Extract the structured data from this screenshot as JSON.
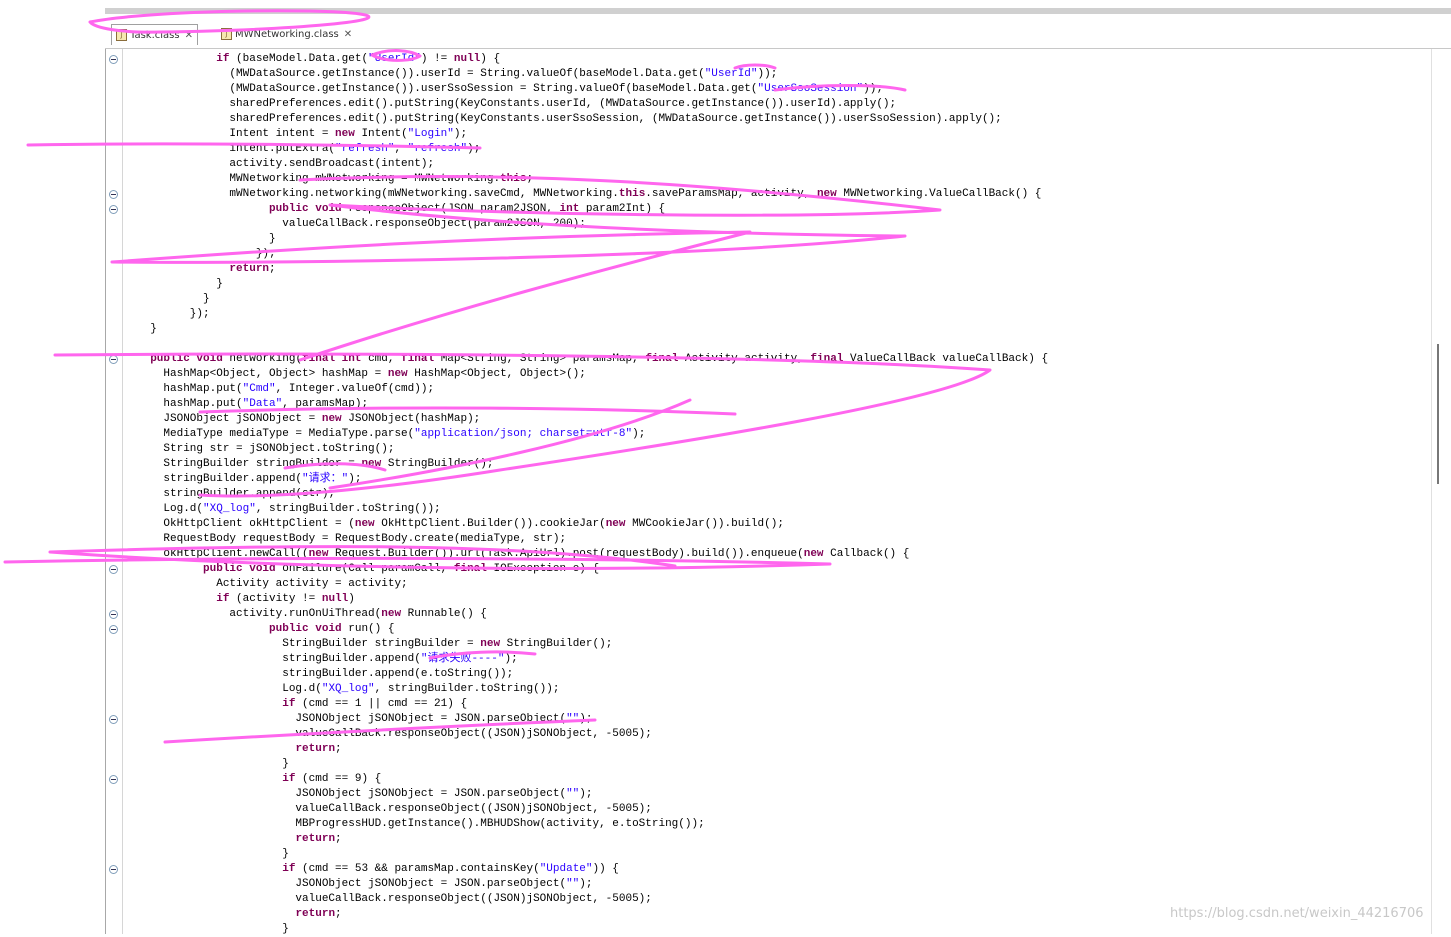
{
  "tabs": [
    {
      "label": "Task.class",
      "active": true
    },
    {
      "label": "MWNetworking.class",
      "active": false
    }
  ],
  "code_lines": [
    "            if (baseModel.Data.get(\"UserId\") != null) {",
    "              (MWDataSource.getInstance()).userId = String.valueOf(baseModel.Data.get(\"UserId\"));",
    "              (MWDataSource.getInstance()).userSsoSession = String.valueOf(baseModel.Data.get(\"UserSsoSession\"));",
    "              sharedPreferences.edit().putString(KeyConstants.userId, (MWDataSource.getInstance()).userId).apply();",
    "              sharedPreferences.edit().putString(KeyConstants.userSsoSession, (MWDataSource.getInstance()).userSsoSession).apply();",
    "              Intent intent = new Intent(\"Login\");",
    "              intent.putExtra(\"refresh\", \"refresh\");",
    "              activity.sendBroadcast(intent);",
    "              MWNetworking mWNetworking = MWNetworking.this;",
    "              mWNetworking.networking(mWNetworking.saveCmd, MWNetworking.this.saveParamsMap, activity, new MWNetworking.ValueCallBack() {",
    "                    public void responseObject(JSON param2JSON, int param2Int) {",
    "                      valueCallBack.responseObject(param2JSON, 200);",
    "                    }",
    "                  });",
    "              return;",
    "            }",
    "          }",
    "        });",
    "  }",
    "",
    "  public void networking(final int cmd, final Map<String, String> paramsMap, final Activity activity, final ValueCallBack valueCallBack) {",
    "    HashMap<Object, Object> hashMap = new HashMap<Object, Object>();",
    "    hashMap.put(\"Cmd\", Integer.valueOf(cmd));",
    "    hashMap.put(\"Data\", paramsMap);",
    "    JSONObject jSONObject = new JSONObject(hashMap);",
    "    MediaType mediaType = MediaType.parse(\"application/json; charset=utf-8\");",
    "    String str = jSONObject.toString();",
    "    StringBuilder stringBuilder = new StringBuilder();",
    "    stringBuilder.append(\"请求：\");",
    "    stringBuilder.append(str);",
    "    Log.d(\"XQ_log\", stringBuilder.toString());",
    "    OkHttpClient okHttpClient = (new OkHttpClient.Builder()).cookieJar(new MWCookieJar()).build();",
    "    RequestBody requestBody = RequestBody.create(mediaType, str);",
    "    okHttpClient.newCall((new Request.Builder()).url(Task.ApiUrl).post(requestBody).build()).enqueue(new Callback() {",
    "          public void onFailure(Call paramCall, final IOException e) {",
    "            Activity activity = activity;",
    "            if (activity != null)",
    "              activity.runOnUiThread(new Runnable() {",
    "                    public void run() {",
    "                      StringBuilder stringBuilder = new StringBuilder();",
    "                      stringBuilder.append(\"请求失败----\");",
    "                      stringBuilder.append(e.toString());",
    "                      Log.d(\"XQ_log\", stringBuilder.toString());",
    "                      if (cmd == 1 || cmd == 21) {",
    "                        JSONObject jSONObject = JSON.parseObject(\"\");",
    "                        valueCallBack.responseObject((JSON)jSONObject, -5005);",
    "                        return;",
    "                      }",
    "                      if (cmd == 9) {",
    "                        JSONObject jSONObject = JSON.parseObject(\"\");",
    "                        valueCallBack.responseObject((JSON)jSONObject, -5005);",
    "                        MBProgressHUD.getInstance().MBHUDShow(activity, e.toString());",
    "                        return;",
    "                      }",
    "                      if (cmd == 53 && paramsMap.containsKey(\"Update\")) {",
    "                        JSONObject jSONObject = JSON.parseObject(\"\");",
    "                        valueCallBack.responseObject((JSON)jSONObject, -5005);",
    "                        return;",
    "                      }"
  ],
  "syntax": {
    "keywords": [
      "public",
      "void",
      "final",
      "new",
      "return",
      "if",
      "int",
      "this",
      "null"
    ],
    "keyword_color": "#7f0055",
    "string_color": "#2a00ff",
    "field_color": "#0000c0",
    "text_color": "#000000"
  },
  "annotation_color": "#ff66ee",
  "watermark": "https://blog.csdn.net/weixin_44216706"
}
